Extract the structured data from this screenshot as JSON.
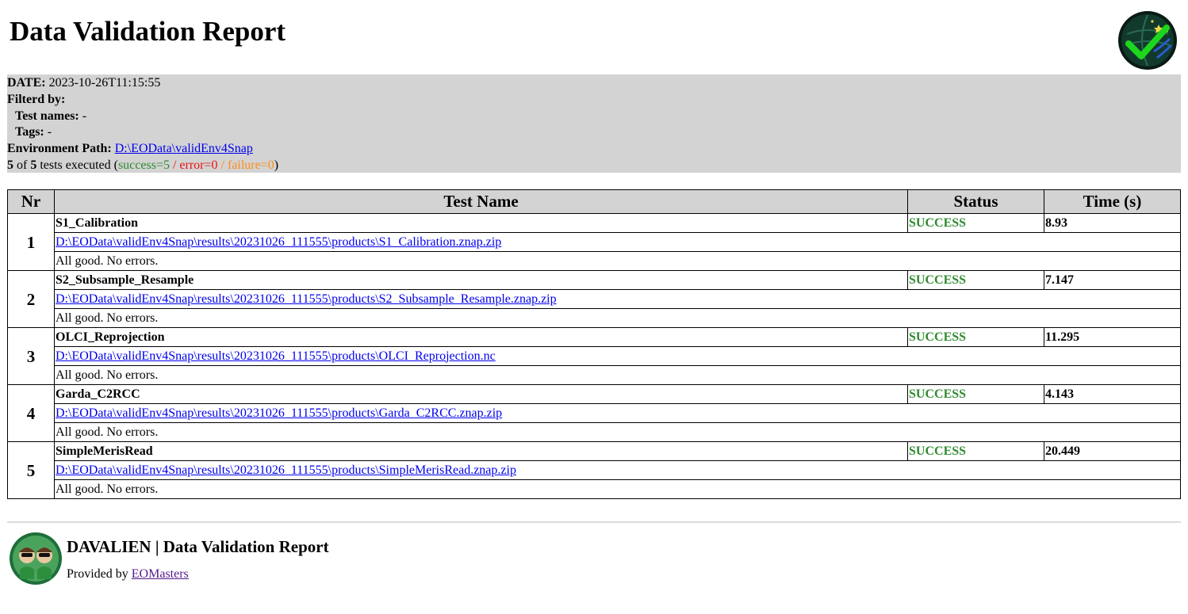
{
  "title": "Data Validation Report",
  "logo_icon": "globe-checkmark-icon",
  "info": {
    "date_label": "DATE:",
    "date_value": "2023-10-26T11:15:55",
    "filtered_label": "Filterd by:",
    "test_names_label": "Test names:",
    "test_names_value": "-",
    "tags_label": "Tags:",
    "tags_value": "-",
    "env_path_label": "Environment Path:",
    "env_path_value": "D:\\EOData\\validEnv4Snap",
    "summary": {
      "executed": "5",
      "of_text": "of",
      "total": "5",
      "tests_text": "tests executed (",
      "success": "success=5",
      "sep1": " / ",
      "error": "error=0",
      "sep2": " / ",
      "failure": "failure=0",
      "close": ")"
    }
  },
  "table": {
    "headers": {
      "nr": "Nr",
      "name": "Test Name",
      "status": "Status",
      "time": "Time (s)"
    },
    "rows": [
      {
        "nr": "1",
        "name": "S1_Calibration",
        "status": "SUCCESS",
        "time": "8.93",
        "path": "D:\\EOData\\validEnv4Snap\\results\\20231026_111555\\products\\S1_Calibration.znap.zip",
        "message": "All good. No errors."
      },
      {
        "nr": "2",
        "name": "S2_Subsample_Resample",
        "status": "SUCCESS",
        "time": "7.147",
        "path": "D:\\EOData\\validEnv4Snap\\results\\20231026_111555\\products\\S2_Subsample_Resample.znap.zip",
        "message": "All good. No errors."
      },
      {
        "nr": "3",
        "name": "OLCI_Reprojection",
        "status": "SUCCESS",
        "time": "11.295",
        "path": "D:\\EOData\\validEnv4Snap\\results\\20231026_111555\\products\\OLCI_Reprojection.nc",
        "message": "All good. No errors."
      },
      {
        "nr": "4",
        "name": "Garda_C2RCC",
        "status": "SUCCESS",
        "time": "4.143",
        "path": "D:\\EOData\\validEnv4Snap\\results\\20231026_111555\\products\\Garda_C2RCC.znap.zip",
        "message": "All good. No errors."
      },
      {
        "nr": "5",
        "name": "SimpleMerisRead",
        "status": "SUCCESS",
        "time": "20.449",
        "path": "D:\\EOData\\validEnv4Snap\\results\\20231026_111555\\products\\SimpleMerisRead.znap.zip",
        "message": "All good. No errors."
      }
    ]
  },
  "footer": {
    "mascot_icon": "mascot-icon",
    "title": "DAVALIEN | Data Validation Report",
    "provided_by": "Provided by",
    "link_text": "EOMasters"
  },
  "colors": {
    "info_background": "#d3d3d3",
    "success": "#2f8a2f",
    "error": "#ee1111",
    "failure": "#ff8c1a",
    "link": "#0000ee",
    "visited_link": "#551a8b"
  }
}
